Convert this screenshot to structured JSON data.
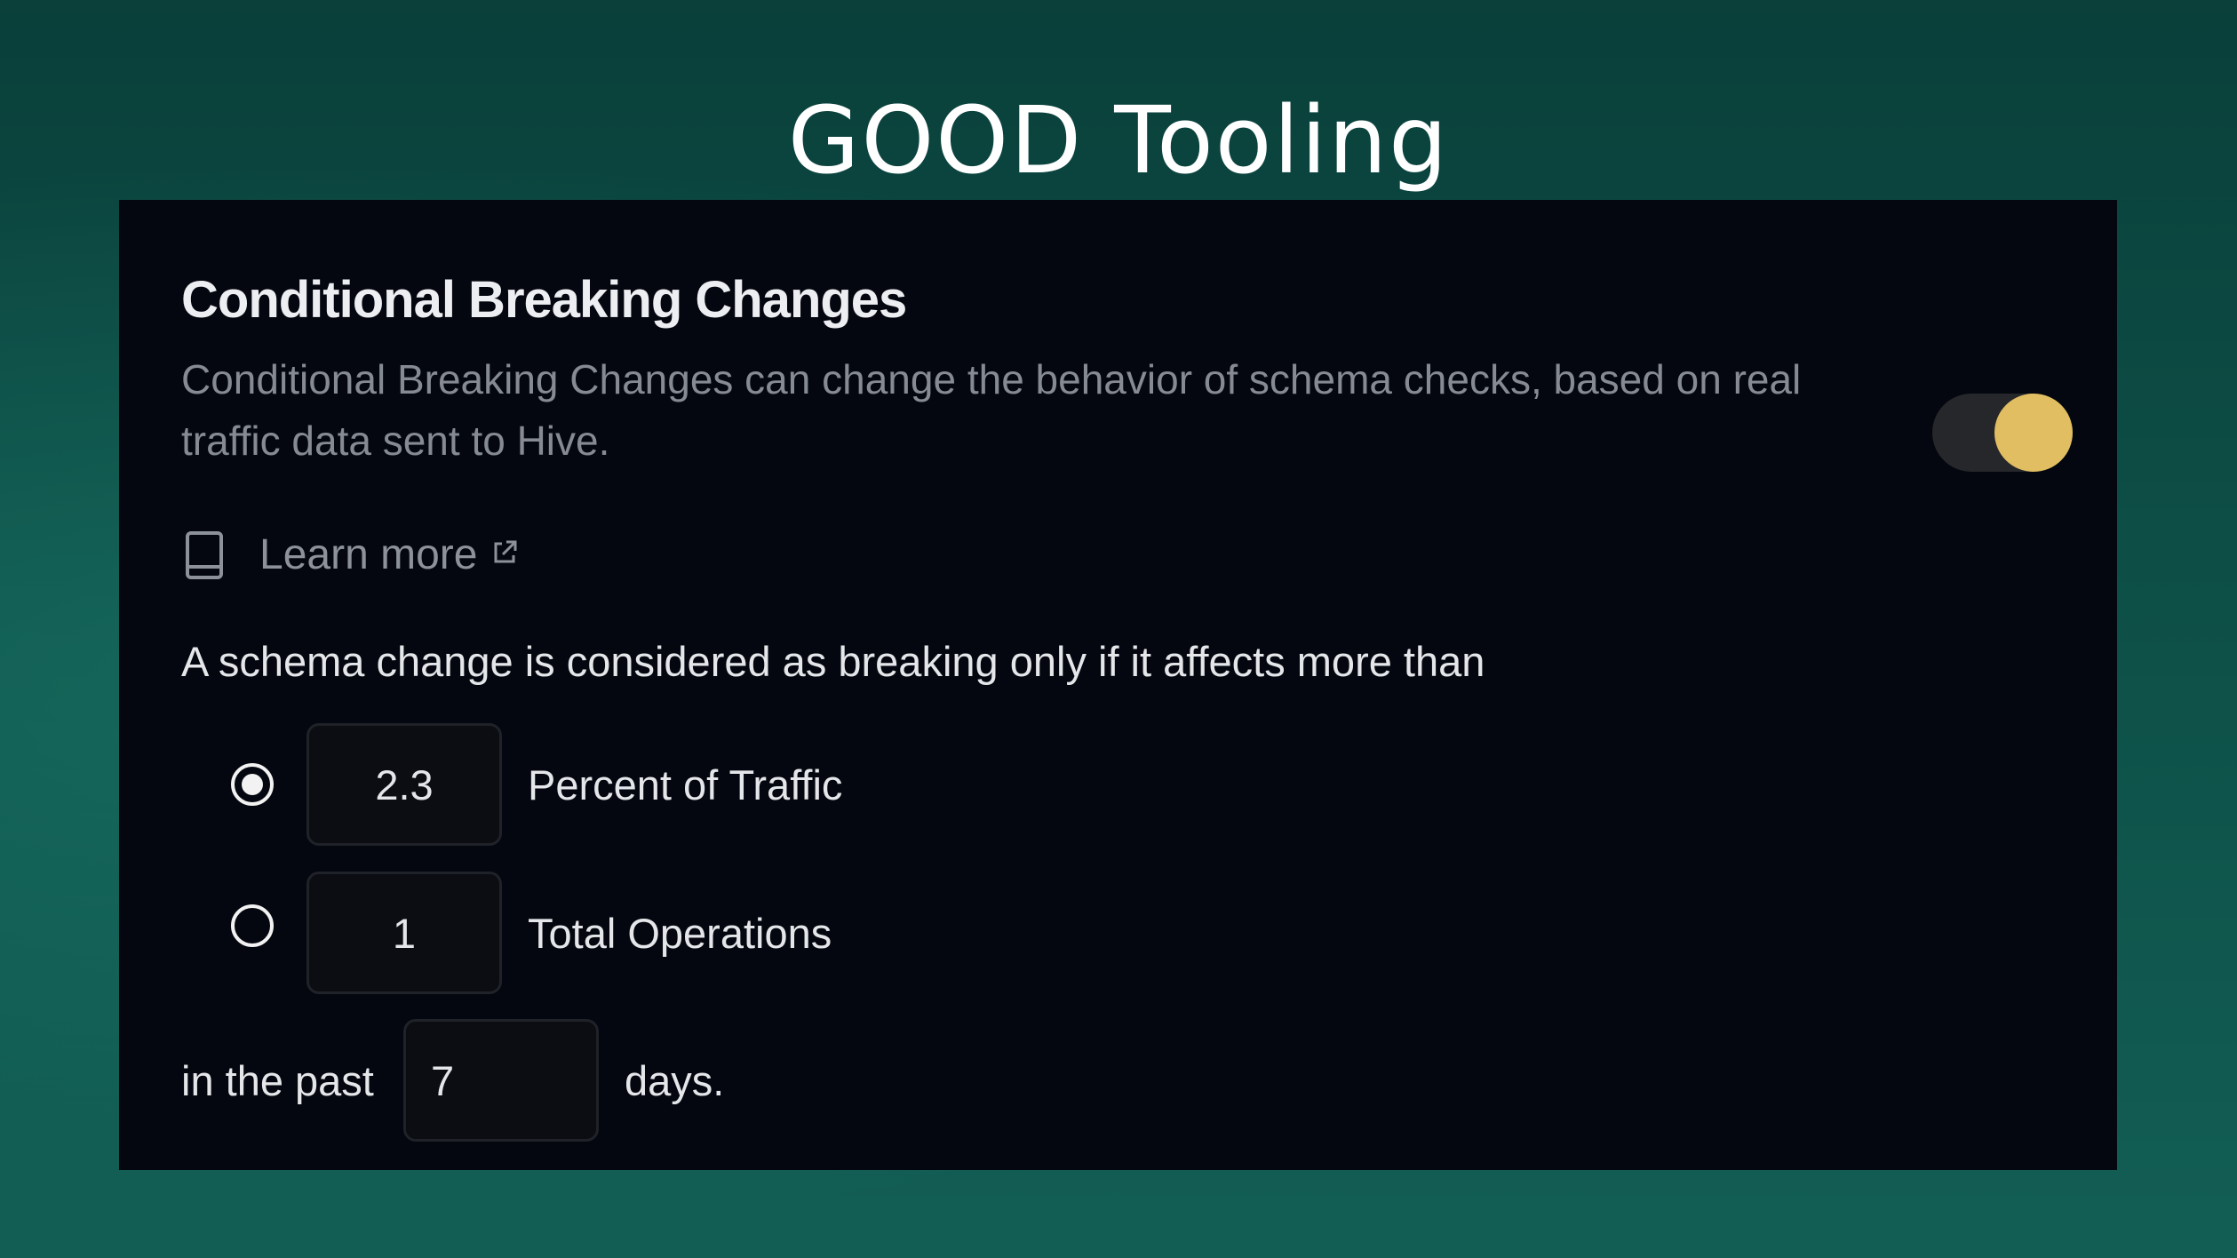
{
  "slide": {
    "title": "GOOD Tooling"
  },
  "panel": {
    "title": "Conditional Breaking Changes",
    "description": "Conditional Breaking Changes can change the behavior of schema checks, based on real traffic data sent to Hive.",
    "toggle_enabled": true,
    "learn_more": {
      "label": "Learn more",
      "icon": "book-icon",
      "external_icon": "external-link-icon"
    },
    "rule_text": "A schema change is considered as breaking only if it affects more than",
    "options": [
      {
        "value": "2.3",
        "label": "Percent of Traffic",
        "selected": true
      },
      {
        "value": "1",
        "label": "Total Operations",
        "selected": false
      }
    ],
    "period": {
      "prefix": "in the past",
      "value": "7",
      "suffix": "days."
    }
  },
  "colors": {
    "accent": "#e2be62",
    "panel_bg": "#04070f",
    "background": "#0d4f47"
  }
}
